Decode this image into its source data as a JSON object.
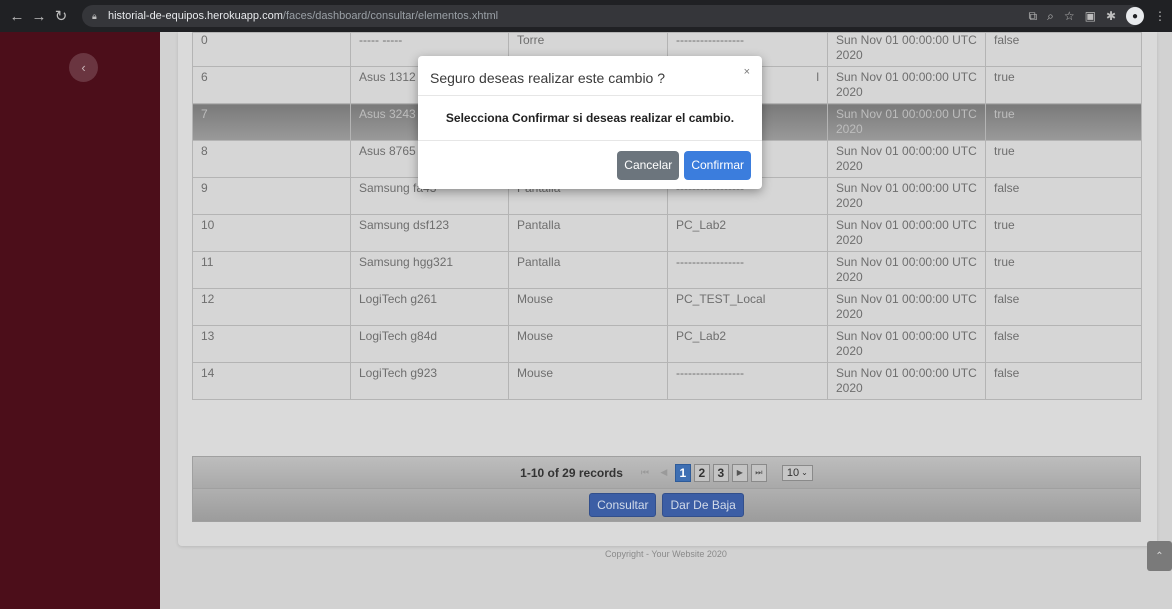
{
  "browser": {
    "url_host": "historial-de-equipos.herokuapp.com",
    "url_path": "/faces/dashboard/consultar/elementos.xhtml"
  },
  "table": {
    "rows": [
      {
        "id": "0",
        "name": "----- -----",
        "type": "Torre",
        "assigned": "-----------------",
        "date": "Sun Nov 01 00:00:00 UTC 2020",
        "active": "false"
      },
      {
        "id": "6",
        "name": "Asus 1312",
        "type": "",
        "assigned": "",
        "date": "Sun Nov 01 00:00:00 UTC 2020",
        "active": "true"
      },
      {
        "id": "7",
        "name": "Asus 3243",
        "type": "",
        "assigned": "",
        "date": "Sun Nov 01 00:00:00 UTC 2020",
        "active": "true"
      },
      {
        "id": "8",
        "name": "Asus 8765",
        "type": "",
        "assigned": "",
        "date": "Sun Nov 01 00:00:00 UTC 2020",
        "active": "true"
      },
      {
        "id": "9",
        "name": "Samsung fa43",
        "type": "Pantalla",
        "assigned": "-----------------",
        "date": "Sun Nov 01 00:00:00 UTC 2020",
        "active": "false"
      },
      {
        "id": "10",
        "name": "Samsung dsf123",
        "type": "Pantalla",
        "assigned": "PC_Lab2",
        "date": "Sun Nov 01 00:00:00 UTC 2020",
        "active": "true"
      },
      {
        "id": "11",
        "name": "Samsung hgg321",
        "type": "Pantalla",
        "assigned": "-----------------",
        "date": "Sun Nov 01 00:00:00 UTC 2020",
        "active": "true"
      },
      {
        "id": "12",
        "name": "LogiTech g261",
        "type": "Mouse",
        "assigned": "PC_TEST_Local",
        "date": "Sun Nov 01 00:00:00 UTC 2020",
        "active": "false"
      },
      {
        "id": "13",
        "name": "LogiTech g84d",
        "type": "Mouse",
        "assigned": "PC_Lab2",
        "date": "Sun Nov 01 00:00:00 UTC 2020",
        "active": "false"
      },
      {
        "id": "14",
        "name": "LogiTech g923",
        "type": "Mouse",
        "assigned": "-----------------",
        "date": "Sun Nov 01 00:00:00 UTC 2020",
        "active": "false"
      }
    ],
    "selected_row_id": "7",
    "partial_cell_2_4": "l"
  },
  "paginator": {
    "records_label": "1-10 of 29 records",
    "pages": [
      "1",
      "2",
      "3"
    ],
    "active_page": "1",
    "rows_per_page": "10"
  },
  "actions": {
    "consultar_label": "Consultar",
    "dar_de_baja_label": "Dar De Baja"
  },
  "footer": {
    "copyright": "Copyright - Your Website 2020"
  },
  "modal": {
    "title": "Seguro deseas realizar este cambio ?",
    "close_symbol": "×",
    "message": "Selecciona Confirmar si deseas realizar el cambio.",
    "cancel_label": "Cancelar",
    "confirm_label": "Confirmar"
  },
  "colors": {
    "sidebar": "#4c0e1a",
    "primary": "#3b7ddd",
    "secondary": "#6c757d"
  }
}
